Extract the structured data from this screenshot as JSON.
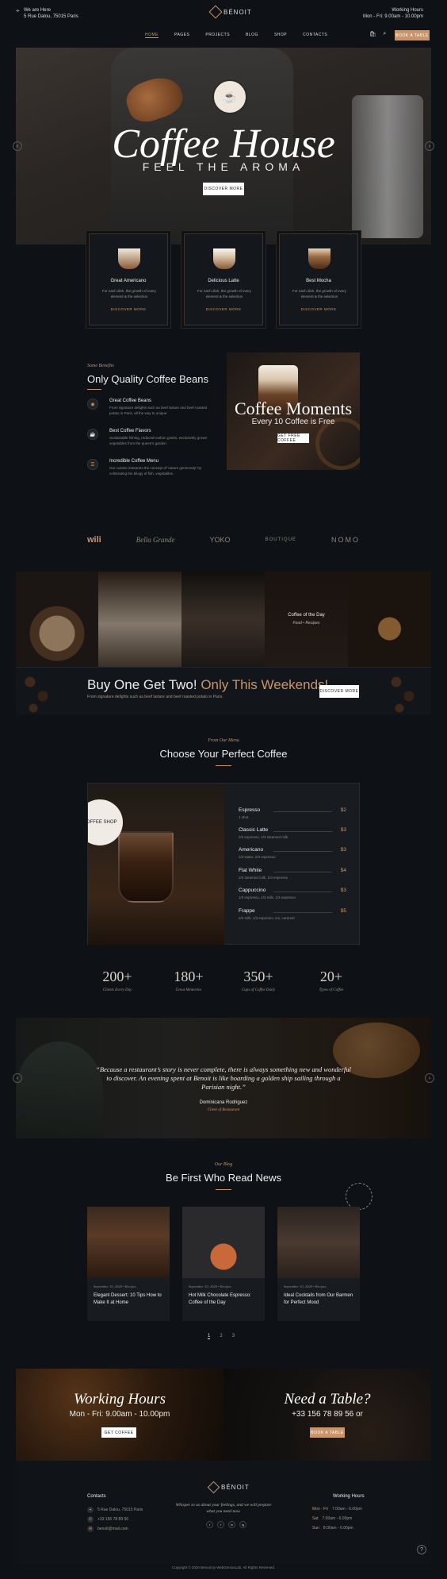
{
  "header": {
    "location_title": "We are Here",
    "location_address": "5 Rue Dalou, 75015 Paris",
    "brand": "BÉNOIT",
    "hours_title": "Working Hours",
    "hours_value": "Mon - Fri: 9.00am - 10.00pm",
    "nav": [
      "HOME",
      "PAGES",
      "PROJECTS",
      "BLOG",
      "SHOP",
      "CONTACTS"
    ],
    "cart_count": "0",
    "book_button": "BOOK A TABLE"
  },
  "hero": {
    "title": "Coffee House",
    "subtitle": "FEEL THE AROMA",
    "cta": "DISCOVER MORE"
  },
  "cards": [
    {
      "name": "Great Americano",
      "desc": "For each dish, the growth of every element & the selection",
      "more": "DISCOVER MORE"
    },
    {
      "name": "Delicious Latte",
      "desc": "For each dish, the growth of every element & the selection",
      "more": "DISCOVER MORE"
    },
    {
      "name": "Best Mocha",
      "desc": "For each dish, the growth of every element & the selection",
      "more": "DISCOVER MORE"
    }
  ],
  "benefits": {
    "kicker": "Some Benefits",
    "title": "Only Quality Coffee Beans",
    "items": [
      {
        "title": "Great Coffee Beans",
        "desc": "From signature delights such as beef tartare and beef roasted potato in Paris, all the way to unique."
      },
      {
        "title": "Best Coffee Flavors",
        "desc": "Sustainable fishing, reduced-carbon grains, exclusively grown vegetables from the queen's garden."
      },
      {
        "title": "Incredible Coffee Menu",
        "desc": "Our cuisine interprets the concept of 'nature generosity' by celebrating the bilogy of fish, vegetables."
      }
    ]
  },
  "moments": {
    "title": "Coffee Moments",
    "promo": "Every 10 Coffee is Free",
    "button": "GET FREE COFFEE"
  },
  "partners": [
    "wili",
    "Bella Grande",
    "YOKO",
    "BOUTIQUE",
    "NOMO"
  ],
  "gallery": {
    "caption_title": "Coffee of the Day",
    "caption_sub": "Food • Recipes"
  },
  "promo": {
    "title_a": "Buy One Get Two!",
    "title_b": " Only This Weekends!",
    "desc": "From signature delights such as beef tartare and beef roasted potato in Paris.",
    "button": "DISCOVER MORE"
  },
  "menu": {
    "kicker": "From Our Menu",
    "title": "Choose Your Perfect Coffee",
    "stamp": "COFFEE SHOP",
    "items": [
      {
        "name": "Espresso",
        "price": "$2",
        "desc": "1 shot"
      },
      {
        "name": "Classic Latte",
        "price": "$3",
        "desc": "2/3 espresso, 1/3 steamed milk"
      },
      {
        "name": "Americano",
        "price": "$3",
        "desc": "1/3 water, 2/3 espresso"
      },
      {
        "name": "Flat White",
        "price": "$4",
        "desc": "2/3 steamed milk, 1/3 espresso"
      },
      {
        "name": "Cappuccino",
        "price": "$3",
        "desc": "1/3 espresso, 1/3 milk, 1/3 espresso"
      },
      {
        "name": "Frappe",
        "price": "$5",
        "desc": "2/3 milk, 1/3 espresso, ice, caramel"
      }
    ]
  },
  "stats": [
    {
      "value": "200+",
      "label": "Clients Every Day"
    },
    {
      "value": "180+",
      "label": "Great Memories"
    },
    {
      "value": "350+",
      "label": "Cups of Coffee Daily"
    },
    {
      "value": "20+",
      "label": "Types of Coffee"
    }
  ],
  "testimonial": {
    "quote": "“Because a restaurant’s story is never complete, there is always something new and wonderful to discover. An evening spent at Benoit is like boarding a golden ship sailing through a Parisian night.”",
    "author": "Dominicana Rodriguez",
    "role": "Client of Restaurant"
  },
  "blog": {
    "kicker": "Our Blog",
    "title": "Be First Who Read News",
    "posts": [
      {
        "meta": "September 10, 2020  •  Recipes",
        "title": "Elegant Dessert: 10 Tips How to Make It at Home"
      },
      {
        "meta": "September 10, 2020  •  Recipes",
        "title": "Hot Milk Chocolate Espresso: Coffee of the Day"
      },
      {
        "meta": "September 10, 2020  •  Recipes",
        "title": "Ideal Cocktails from Our Barmen for Perfect Mood"
      }
    ],
    "pages": [
      "1",
      "2",
      "3"
    ]
  },
  "working_hours": {
    "title": "Working Hours",
    "value": "Mon - Fri: 9.00am - 10.00pm",
    "button": "GET COFFEE"
  },
  "need_table": {
    "title": "Need a Table?",
    "phone": "+33 156 78 89 56",
    "or": "or",
    "button": "BOOK A TABLE"
  },
  "footer": {
    "contacts_title": "Contacts",
    "address": "5 Rue Dalou, 75015 Paris",
    "phone": "+33 156 78 89 56",
    "email": "benoit@mail.com",
    "brand": "BÉNOIT",
    "tagline": "Whisper to us about your feelings, and we will prepare what you need now.",
    "hours_title": "Working Hours",
    "hours": [
      {
        "day": "Mon - Fri",
        "time": "7.00am - 6.00pm"
      },
      {
        "day": "Sat",
        "time": "7.00am - 6.00pm"
      },
      {
        "day": "Sun",
        "time": "8.00am - 6.00pm"
      }
    ],
    "social": [
      "t",
      "f",
      "in",
      "ig"
    ],
    "copyright": "Copyright © 2020 Benoit by WebGeniusLab. All Rights Reserved."
  }
}
